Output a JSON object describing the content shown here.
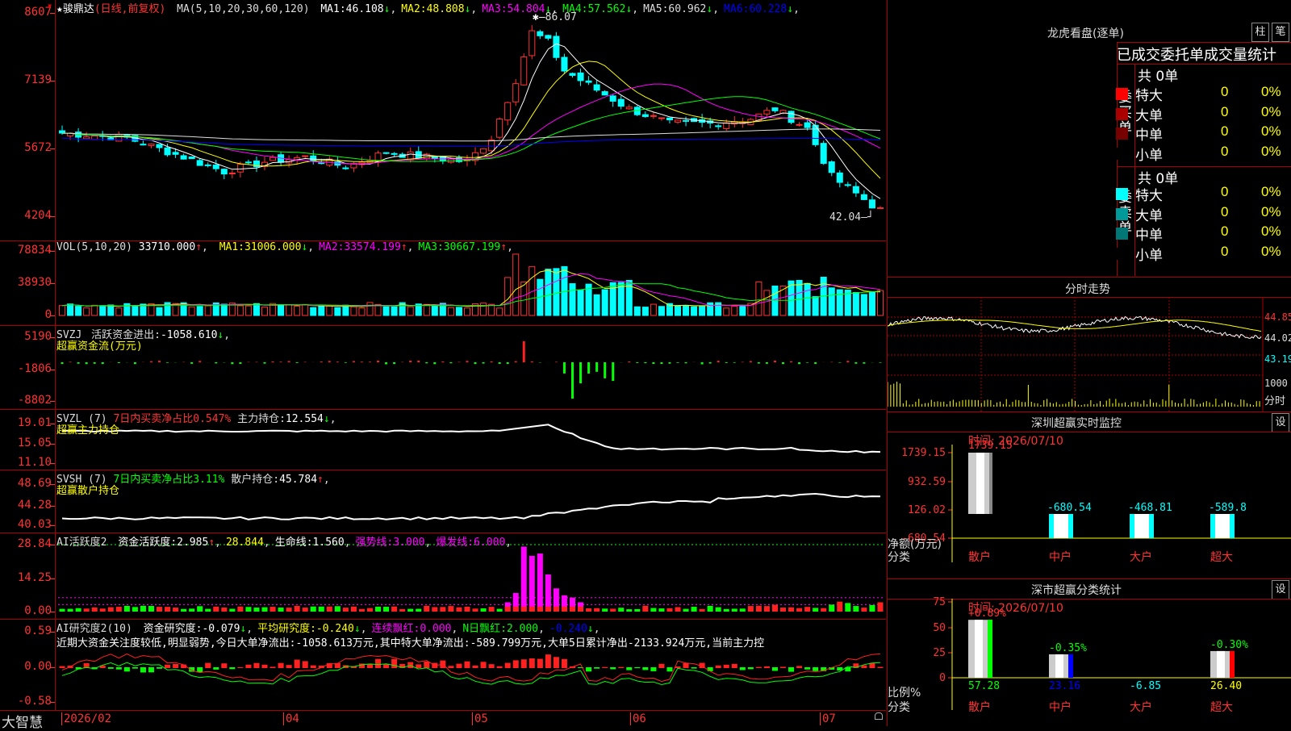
{
  "stock": {
    "name": "骏鼎达",
    "mode": "(日线,前复权)",
    "star": "★",
    "ma_label": "MA(5,10,20,30,60,120)",
    "ma_values": [
      {
        "k": "MA1:",
        "v": "46.108",
        "arr": "↓",
        "color": "#ffffff"
      },
      {
        "k": "MA2:",
        "v": "48.808",
        "arr": "↓",
        "color": "#ffff00"
      },
      {
        "k": "MA3:",
        "v": "54.804",
        "arr": "↓",
        "color": "#ff00ff"
      },
      {
        "k": "MA4:",
        "v": "57.562",
        "arr": "↓",
        "color": "#00ff00"
      },
      {
        "k": "MA5:",
        "v": "60.962",
        "arr": "↓",
        "color": "#dddddd"
      },
      {
        "k": "MA6:",
        "v": "60.228",
        "arr": "↓",
        "color": "#0000ff"
      }
    ],
    "high_label": "86.07",
    "low_label": "42.04"
  },
  "price_axis": [
    "8607",
    "7139",
    "5672",
    "4204"
  ],
  "volume": {
    "label": "VOL(5,10,20)",
    "value": "33710.000",
    "arrow": "↑",
    "ma": [
      {
        "k": "MA1:",
        "v": "31006.000",
        "arr": "↓",
        "color": "#ffff00"
      },
      {
        "k": "MA2:",
        "v": "33574.199",
        "arr": "↑",
        "color": "#ff00ff"
      },
      {
        "k": "MA3:",
        "v": "30667.199",
        "arr": "↑",
        "color": "#00ff00"
      }
    ],
    "axis": [
      "78834",
      "38930",
      "0"
    ]
  },
  "svzj": {
    "label": "SVZJ",
    "title": "活跃资金进出:",
    "value": "-1058.610",
    "arrow": "↓",
    "subtitle": "超赢资金流(万元)",
    "axis": [
      "5190",
      "-1806",
      "-8802"
    ]
  },
  "svzl": {
    "label": "SVZL (7)",
    "title": "7日内买卖净占比0.547%",
    "main": "主力持仓:",
    "value": "12.554",
    "arrow": "↓",
    "subtitle": "超赢主力持仓",
    "axis": [
      "19.01",
      "15.05",
      "11.10"
    ]
  },
  "svsh": {
    "label": "SVSH (7)",
    "title": "7日内买卖净占比3.11%",
    "main": "散户持仓:",
    "value": "45.784",
    "arrow": "↑",
    "subtitle": "超赢散户持仓",
    "axis": [
      "48.69",
      "44.28",
      "40.03"
    ]
  },
  "ai_active": {
    "label": "AI活跃度2",
    "items": [
      {
        "k": "资金活跃度:",
        "v": "2.985",
        "arr": "↑",
        "color": "#ffffff"
      },
      {
        "k": "",
        "v": "28.844",
        "arr": "",
        "color": "#ffff00"
      },
      {
        "k": "生命线:",
        "v": "1.560",
        "arr": "",
        "color": "#ffffff"
      },
      {
        "k": "强势线:",
        "v": "3.000",
        "arr": "",
        "color": "#ff00ff"
      },
      {
        "k": "爆发线:",
        "v": "6.000",
        "arr": "",
        "color": "#ff00ff"
      }
    ],
    "axis": [
      "28.84",
      "14.25",
      "0.00"
    ]
  },
  "ai_research": {
    "label": "AI研究度2(10)",
    "items": [
      {
        "k": "资金研究度:",
        "v": "-0.079",
        "arr": "↓",
        "color": "#ffffff"
      },
      {
        "k": "平均研究度:",
        "v": "-0.240",
        "arr": "↓",
        "color": "#ffff00"
      },
      {
        "k": "连续飘红:",
        "v": "0.000",
        "arr": "",
        "color": "#ff00ff"
      },
      {
        "k": "N日飘红:",
        "v": "2.000",
        "arr": "",
        "color": "#00ff00"
      },
      {
        "k": "",
        "v": "-0.240",
        "arr": "↓",
        "color": "#0000ff"
      }
    ],
    "comment": "近期大资金关注度较低,明显弱势,今日大单净流出:-1058.613万元,其中特大单净流出:-589.799万元,大单5日累计净出-2133.924万元,当前主力控",
    "axis": [
      "0.59",
      "0.00",
      "-0.58"
    ]
  },
  "bottom": {
    "brand": "大智慧",
    "dates": [
      "2026/02",
      "04",
      "05",
      "06",
      "07"
    ]
  },
  "dragon": {
    "title": "龙虎看盘(逐单)",
    "btn1": "柱",
    "btn2": "笔",
    "subtitle": "已成交委托单成交量统计",
    "buy_label": "委买单",
    "sell_label": "委卖单",
    "buy_total": "共 0单",
    "sell_total": "共 0单",
    "buy_rows": [
      {
        "name": "特大",
        "n": "0",
        "p": "0%",
        "color": "#ff0000"
      },
      {
        "name": "大单",
        "n": "0",
        "p": "0%",
        "color": "#aa0000"
      },
      {
        "name": "中单",
        "n": "0",
        "p": "0%",
        "color": "#770000"
      },
      {
        "name": "小单",
        "n": "0",
        "p": "0%",
        "color": "#000000"
      }
    ],
    "sell_rows": [
      {
        "name": "特大",
        "n": "0",
        "p": "0%",
        "color": "#00ffff"
      },
      {
        "name": "大单",
        "n": "0",
        "p": "0%",
        "color": "#009999"
      },
      {
        "name": "中单",
        "n": "0",
        "p": "0%",
        "color": "#007777"
      },
      {
        "name": "小单",
        "n": "0",
        "p": "0%",
        "color": "#000000"
      }
    ]
  },
  "intraday": {
    "title": "分时走势",
    "axis": [
      "44.85",
      "44.02",
      "43.19"
    ],
    "vol_label": "1000",
    "vol_unit": "分时"
  },
  "sz_monitor": {
    "title": "深圳超赢实时监控",
    "btn": "设",
    "time": "时间: 2026/07/10",
    "axis": [
      "1739.15",
      "932.59",
      "126.02",
      "-680.54"
    ],
    "ylabel": "净额(万元)",
    "xlabel": "分类",
    "top_value": "1739.15",
    "bars": [
      {
        "cat": "散户",
        "v": "1739.15"
      },
      {
        "cat": "中户",
        "v": "-680.54"
      },
      {
        "cat": "大户",
        "v": "-468.81"
      },
      {
        "cat": "超大",
        "v": "-589.8"
      }
    ]
  },
  "sz_stats": {
    "title": "深市超赢分类统计",
    "btn": "设",
    "time": "时间: 2026/07/10",
    "axis": [
      "75",
      "50",
      "25",
      "0"
    ],
    "ylabel": "比例%",
    "xlabel": "分类",
    "bars": [
      {
        "cat": "散户",
        "top": "+0.89%",
        "bottom": "57.28",
        "color": "#00ff00"
      },
      {
        "cat": "中户",
        "top": "-0.35%",
        "bottom": "23.16",
        "color": "#0000ff"
      },
      {
        "cat": "大户",
        "top": "",
        "bottom": "-6.85",
        "color": "#00ffff"
      },
      {
        "cat": "超大",
        "top": "-0.30%",
        "bottom": "26.40",
        "color": "#ff0000"
      }
    ]
  }
}
